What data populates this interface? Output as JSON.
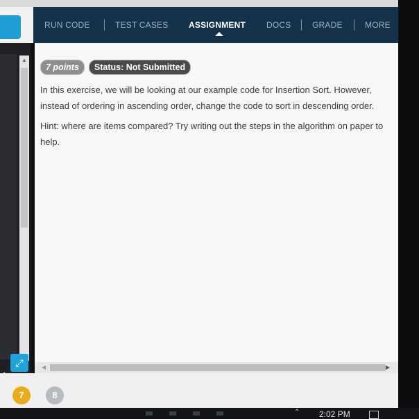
{
  "navbar": {
    "items": [
      {
        "label": "RUN CODE",
        "active": false
      },
      {
        "label": "TEST CASES",
        "active": false
      },
      {
        "label": "ASSIGNMENT",
        "active": true
      },
      {
        "label": "DOCS",
        "active": false
      },
      {
        "label": "GRADE",
        "active": false
      },
      {
        "label": "MORE",
        "active": false
      }
    ]
  },
  "assignment": {
    "points_badge": "7 points",
    "status_badge": "Status: Not Submitted",
    "paragraph_1": "In this exercise, we will be looking at our example code for Insertion Sort. However, instead of ordering in ascending order, change the code to sort in descending order.",
    "paragraph_2": "Hint: where are items compared? Try writing out the steps in the algorithm on paper to help."
  },
  "steps": {
    "current": "7",
    "next": "8"
  },
  "taskbar": {
    "clock": "2:02 PM"
  },
  "colors": {
    "navbar_bg": "#14324a",
    "accent_blue": "#1fa3d8",
    "step_current": "#e9ad1b",
    "step_next": "#b6bcbf"
  },
  "icons": {
    "expand": "expand-arrows-icon",
    "cursor": "mouse-pointer-icon"
  }
}
